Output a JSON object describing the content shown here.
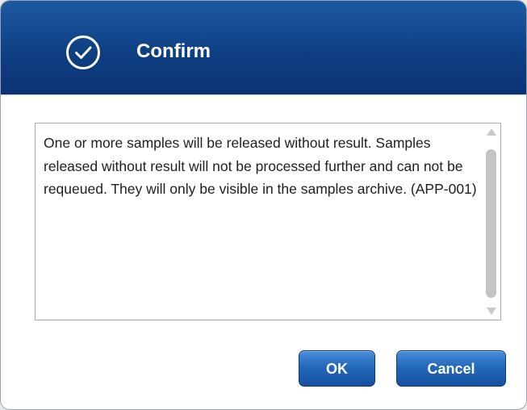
{
  "dialog": {
    "title": "Confirm",
    "icon": "check-circle-icon",
    "message": "One or more samples will be released without result. Samples released without result will not be processed further and can not be requeued. They will only be visible in the samples archive. (APP-001)",
    "buttons": {
      "ok_label": "OK",
      "cancel_label": "Cancel"
    },
    "colors": {
      "header": "#0e3f83",
      "button": "#2468bb"
    }
  }
}
